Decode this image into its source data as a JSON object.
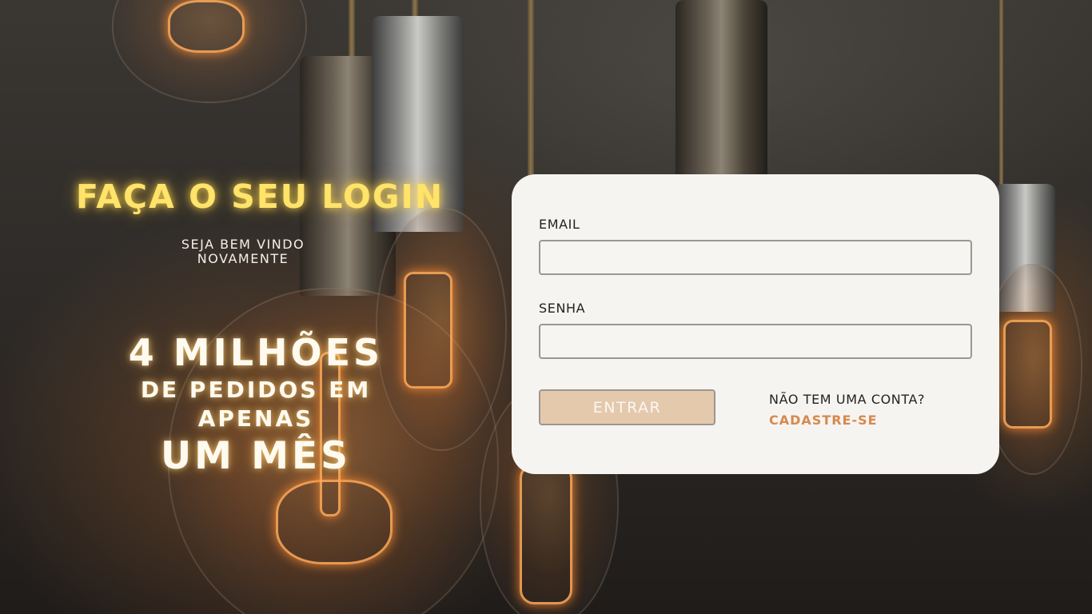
{
  "hero": {
    "title": "FAÇA O SEU LOGIN",
    "subtitle_line1": "SEJA BEM VINDO",
    "subtitle_line2": "NOVAMENTE",
    "promo_line1": "4 MILHÕES",
    "promo_line2": "DE PEDIDOS EM APENAS",
    "promo_line3": "UM MÊS"
  },
  "login": {
    "email_label": "EMAIL",
    "email_value": "",
    "email_placeholder": "",
    "password_label": "SENHA",
    "password_value": "",
    "password_placeholder": "",
    "submit_label": "ENTRAR",
    "no_account_text": "NÃO TEM UMA CONTA?",
    "signup_link": "CADASTRE-SE"
  },
  "colors": {
    "title": "#ffe36a",
    "card_background": "#f6f4f1",
    "button_background": "#e5c9ad",
    "link": "#d58a4e"
  }
}
